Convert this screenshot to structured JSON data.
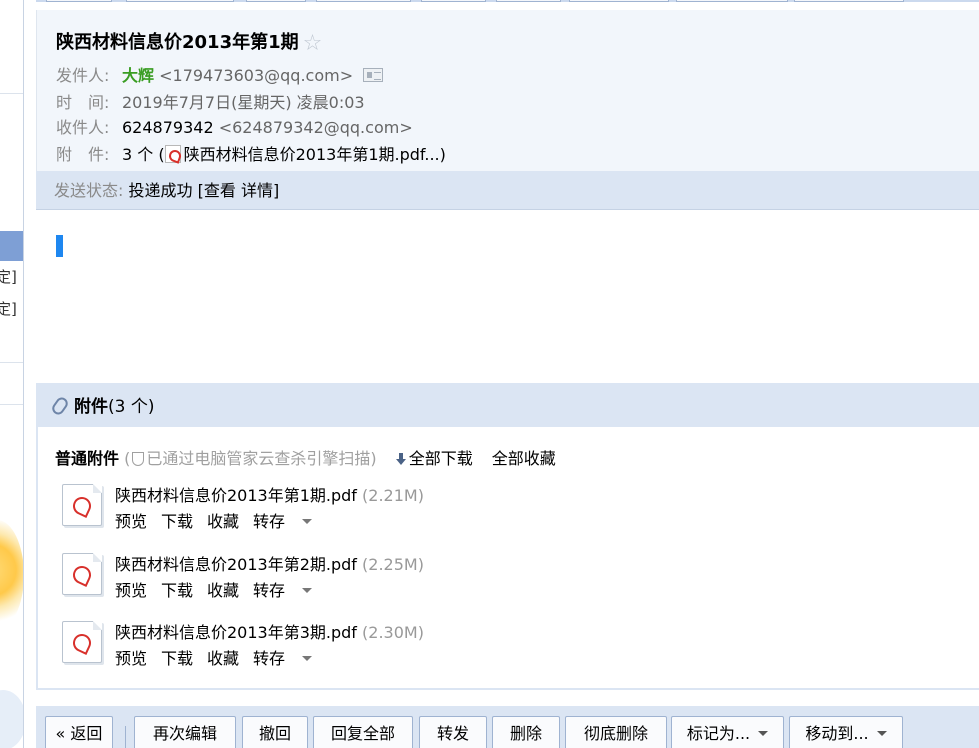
{
  "sidebar": {
    "items": [
      "定]",
      "定]"
    ]
  },
  "mail": {
    "subject": "陕西材料信息价2013年第1期",
    "star": "☆",
    "from_label": "发件人:",
    "from_name": "大辉",
    "from_addr": "<179473603@qq.com>",
    "time_label": "时　间:",
    "time_value": "2019年7月7日(星期天) 凌晨0:03",
    "to_label": "收件人:",
    "to_name": "624879342",
    "to_addr": "<624879342@qq.com>",
    "attach_label": "附　件:",
    "attach_count": "3 个 (",
    "attach_first": "陕西材料信息价2013年第1期.pdf...",
    "attach_close": ")",
    "status_label": "发送状态:",
    "status_value": "投递成功",
    "status_link": "[查看 详情]"
  },
  "attachments": {
    "title": "附件",
    "count": "(3 个)",
    "section_title": "普通附件",
    "scan_open": " (",
    "scan_text": "已通过电脑管家云查杀引擎扫描)",
    "download_all": "全部下载",
    "save_all": "全部收藏",
    "files": [
      {
        "name": "陕西材料信息价2013年第1期.pdf",
        "size": "(2.21M)"
      },
      {
        "name": "陕西材料信息价2013年第2期.pdf",
        "size": "(2.25M)"
      },
      {
        "name": "陕西材料信息价2013年第3期.pdf",
        "size": "(2.30M)"
      }
    ],
    "actions": {
      "preview": "预览",
      "download": "下载",
      "collect": "收藏",
      "transfer": "转存"
    }
  },
  "toolbar": {
    "back": "« 返回",
    "reedit": "再次编辑",
    "recall": "撤回",
    "reply_all": "回复全部",
    "forward": "转发",
    "delete": "删除",
    "delete_forever": "彻底删除",
    "mark_as": "标记为...",
    "move_to": "移动到..."
  }
}
